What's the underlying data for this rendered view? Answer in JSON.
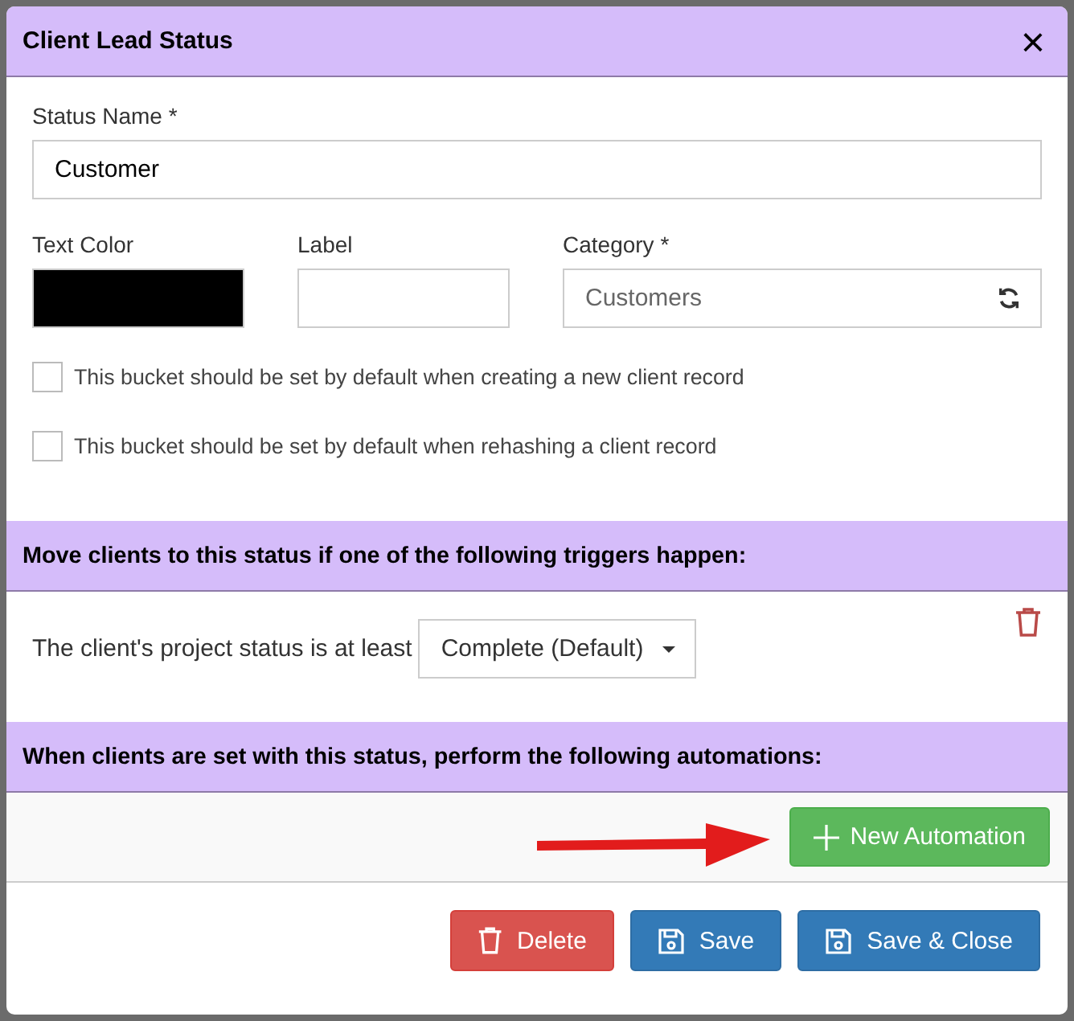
{
  "dialog": {
    "title": "Client Lead Status",
    "close": "×"
  },
  "status_name": {
    "label": "Status Name *",
    "value": "Customer"
  },
  "text_color": {
    "label": "Text Color",
    "color": "#000000"
  },
  "label_field": {
    "label": "Label"
  },
  "category": {
    "label": "Category *",
    "placeholder": "Customers"
  },
  "checkboxes": [
    {
      "label": "This bucket should be set by default when creating a new client record",
      "checked": false
    },
    {
      "label": "This bucket should be set by default when rehashing a client record",
      "checked": false
    }
  ],
  "triggers": {
    "heading": "Move clients to this status if one of the following triggers happen:",
    "rows": [
      {
        "text": "The client's project status is at least",
        "value": "Complete (Default)"
      }
    ]
  },
  "automations": {
    "heading": "When clients are set with this status, perform the following automations:",
    "button": "New Automation"
  },
  "footer_buttons": [
    {
      "label": "Delete",
      "kind": "delete"
    },
    {
      "label": "Save",
      "kind": "save"
    },
    {
      "label": "Save & Close",
      "kind": "save"
    }
  ]
}
